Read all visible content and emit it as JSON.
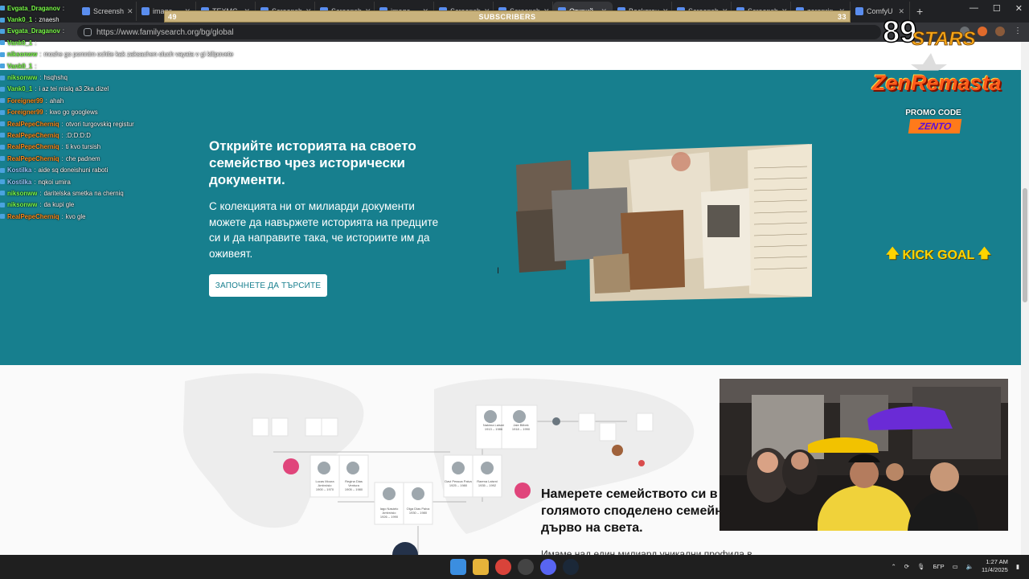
{
  "browser": {
    "tabs": [
      {
        "label": "Screensh"
      },
      {
        "label": "image"
      },
      {
        "label": "TEXMC"
      },
      {
        "label": "Screensh"
      },
      {
        "label": "Screensh"
      },
      {
        "label": "image"
      },
      {
        "label": "Screensh"
      },
      {
        "label": "Screensh"
      },
      {
        "label": "Открий",
        "active": true
      },
      {
        "label": "Backgrou"
      },
      {
        "label": "Screensh"
      },
      {
        "label": "Screensh"
      },
      {
        "label": "zeroprin"
      },
      {
        "label": "ComfyU"
      }
    ],
    "url": "https://www.familysearch.org/bg/global"
  },
  "subscribers": {
    "label": "SUBSCRIBERS",
    "left": "49",
    "right": "33"
  },
  "chat": [
    {
      "user": "Evgata_Draganov",
      "text": "",
      "color": "#7cff4a"
    },
    {
      "user": "Vank0_1",
      "text": "znaesh",
      "color": "#7cff4a"
    },
    {
      "user": "Evgata_Draganov",
      "text": "",
      "color": "#7cff4a"
    },
    {
      "user": "Vank0_1",
      "text": "",
      "color": "#7cff4a"
    },
    {
      "user": "niksonww",
      "text": "moshe go pomnim ochite kak zaksachen oluch vayata v gi kilipovete",
      "color": "#7cff4a"
    },
    {
      "user": "Vank0_1",
      "text": "",
      "color": "#7cff4a"
    },
    {
      "user": "niksonww",
      "text": "hsqhshq",
      "color": "#7cff4a"
    },
    {
      "user": "Vank0_1",
      "text": "i az tei mislq a3 2ka dizel",
      "color": "#7cff4a"
    },
    {
      "user": "Foreigner99",
      "text": "ahah",
      "color": "#ff8c1a"
    },
    {
      "user": "Foreigner99",
      "text": "kwo go googlews",
      "color": "#ff8c1a"
    },
    {
      "user": "RealPepeCherniq",
      "text": "otvori turgovskiq registur",
      "color": "#ff8c1a"
    },
    {
      "user": "RealPepeCherniq",
      "text": ":D:D:D:D",
      "color": "#ff8c1a"
    },
    {
      "user": "RealPepeCherniq",
      "text": "ti kvo tursish",
      "color": "#ff8c1a"
    },
    {
      "user": "RealPepeCherniq",
      "text": "che padnem",
      "color": "#ff8c1a"
    },
    {
      "user": "Kostilka",
      "text": "aide sq doneishuni raboti",
      "color": "#9ec9ff"
    },
    {
      "user": "Kostilka",
      "text": "nqkoi umira",
      "color": "#9ec9ff"
    },
    {
      "user": "niksonww",
      "text": "daritelska smetka na cherniq",
      "color": "#7cff4a"
    },
    {
      "user": "niksonww",
      "text": "da kupi gle",
      "color": "#7cff4a"
    },
    {
      "user": "RealPepeCherniq",
      "text": "kvo gle",
      "color": "#ff8c1a"
    }
  ],
  "hero": {
    "title": "Открийте историята на своето семейство чрез исторически документи.",
    "body": "С колекцията ни от милиарди документи можете да навържете историята на предците си и да направите така, че историите им да оживеят.",
    "cta": "ЗАПОЧНЕТЕ ДА ТЪРСИТЕ"
  },
  "section2": {
    "title": "Намерете семейството си в голямото споделено семейно дърво на света.",
    "snippet": "Имаме над един милиард уникални профила в"
  },
  "tree_people": [
    {
      "name": "Nakima Laismi",
      "years": "1913 – 1986"
    },
    {
      "name": "Jale Bilbek",
      "years": "1918 – 1990"
    },
    {
      "name": "Lucas Moura Ambrósio",
      "years": "1900 – 1970"
    },
    {
      "name": "Regina Dias Ventura",
      "years": "1905 – 1980"
    },
    {
      "name": "Iago Nasário Ambrósio",
      "years": "1926 – 1990"
    },
    {
      "name": "Olga Dias Paiva",
      "years": "1930 – 1980"
    },
    {
      "name": "Davi Pessoa Paiva",
      "years": "1925 – 1980"
    },
    {
      "name": "Raema Laismi",
      "years": "1935 – 1992"
    }
  ],
  "overlay": {
    "stars_label": "STARS",
    "stars_number": "89",
    "brand": "ZenRemasta",
    "promo": "PROMO CODE",
    "code": "ZENTO",
    "kick_goal": "KICK GOAL"
  },
  "taskbar": {
    "lang": "БГР",
    "time": "1:27 AM",
    "date": "11/4/2025"
  }
}
